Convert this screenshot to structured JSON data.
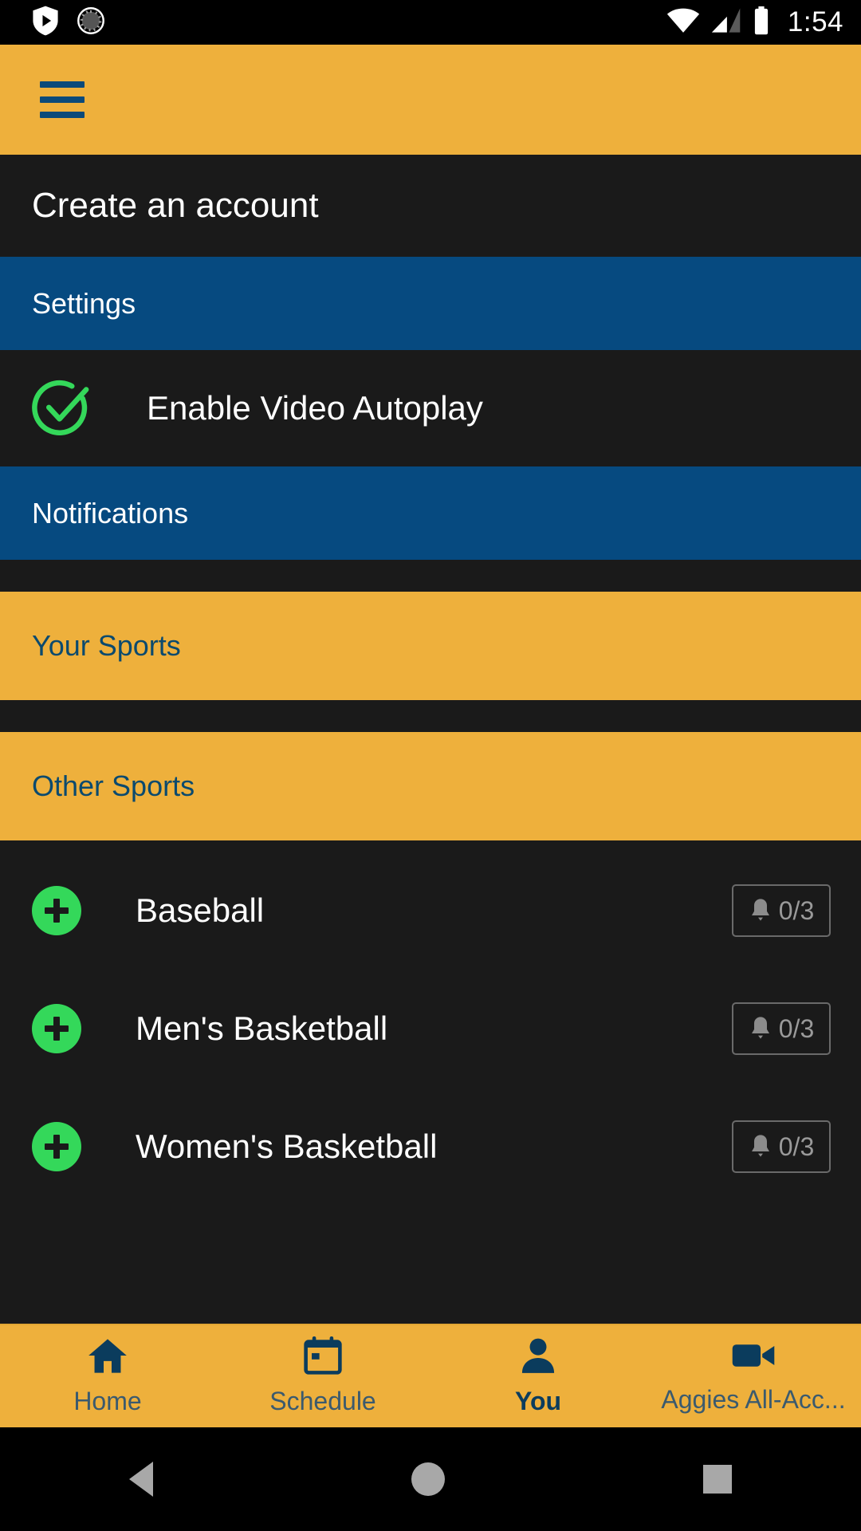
{
  "status_bar": {
    "time": "1:54",
    "icons": [
      "play-protect-icon",
      "sync-spinner-icon",
      "wifi-icon",
      "cell-signal-icon",
      "battery-icon"
    ]
  },
  "app_bar": {
    "menu_icon": "hamburger-menu-icon",
    "background": "#eeb03c",
    "icon_color": "#0b4a7a"
  },
  "colors": {
    "yellow": "#eeb03c",
    "blue_header": "#064a80",
    "dark": "#1a1a1a",
    "green": "#34d85a",
    "blue_text": "#0b4a6e"
  },
  "menu": {
    "create_account": "Create an account",
    "settings_header": "Settings",
    "autoplay": {
      "label": "Enable Video Autoplay",
      "checked": true,
      "icon": "check-circle-icon"
    },
    "notifications_header": "Notifications",
    "your_sports_header": "Your Sports",
    "other_sports_header": "Other Sports"
  },
  "other_sports": [
    {
      "name": "Baseball",
      "add_icon": "plus-circle-icon",
      "bell_icon": "bell-icon",
      "count": "0/3"
    },
    {
      "name": "Men's Basketball",
      "add_icon": "plus-circle-icon",
      "bell_icon": "bell-icon",
      "count": "0/3"
    },
    {
      "name": "Women's Basketball",
      "add_icon": "plus-circle-icon",
      "bell_icon": "bell-icon",
      "count": "0/3"
    }
  ],
  "bottom_nav": {
    "items": [
      {
        "label": "Home",
        "icon": "home-icon",
        "active": false
      },
      {
        "label": "Schedule",
        "icon": "calendar-icon",
        "active": false
      },
      {
        "label": "You",
        "icon": "person-icon",
        "active": true
      },
      {
        "label": "Aggies All-Acc...",
        "icon": "video-camera-icon",
        "active": false
      }
    ]
  },
  "system_nav": {
    "back": "back-button",
    "home": "home-button",
    "recents": "recents-button"
  }
}
